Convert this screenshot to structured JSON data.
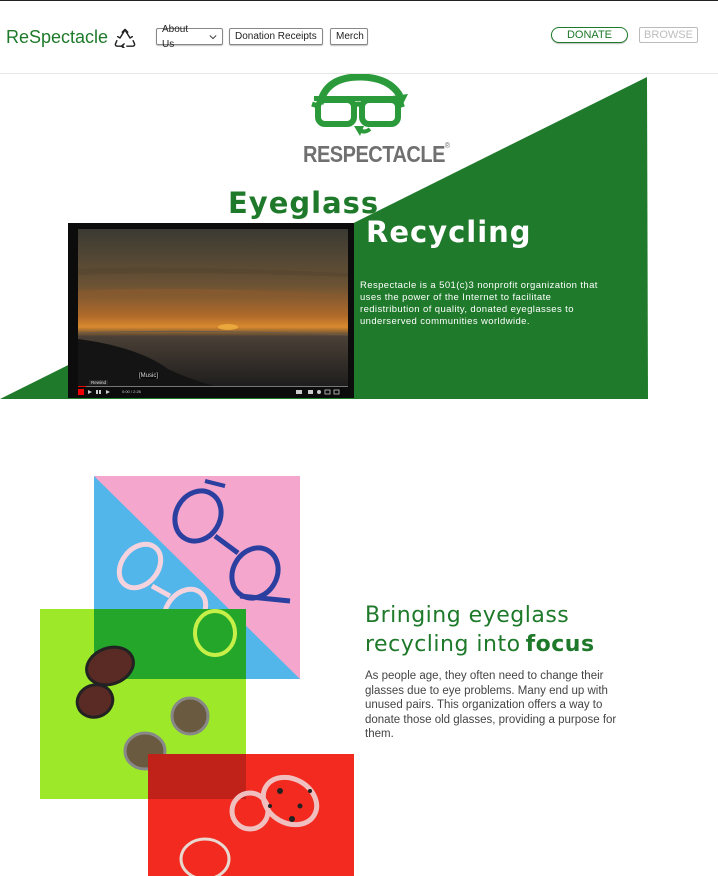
{
  "header": {
    "brand_name": "ReSpectacle",
    "brand_icon": "recycle-icon",
    "nav": {
      "about": "About Us",
      "receipts": "Donation Receipts",
      "merch": "Merch"
    },
    "donate_label": "DONATE",
    "browse_label": "BROWSE"
  },
  "hero": {
    "logo_text": "RESPECTACLE",
    "logo_mark": "®",
    "heading_part1": "Eyeglass",
    "heading_part2": "Recycling",
    "description": "Respectacle is a 501(c)3 nonprofit organization that uses the power of the Internet to facilitate redistribution of quality, donated eyeglasses to underserved communities worldwide.",
    "video": {
      "caption": "[Music]",
      "tooltip": "Rewind",
      "time": "0:00 / 2:26"
    }
  },
  "focus": {
    "heading_line1": "Bringing eyeglass",
    "heading_line2": "recycling into",
    "heading_bold": "focus",
    "body": "As people age, they often need to change their glasses due to eye problems. Many end up with unused pairs. This organization offers a way to donate those old glasses, providing a purpose for them."
  },
  "colors": {
    "brand_green": "#1e7a2a",
    "hero_green": "#1f7a2b",
    "collage_pink": "#f4a6cc",
    "collage_blue": "#53b6ea",
    "collage_lime": "#9ee82a",
    "collage_red": "#f22a1f"
  }
}
